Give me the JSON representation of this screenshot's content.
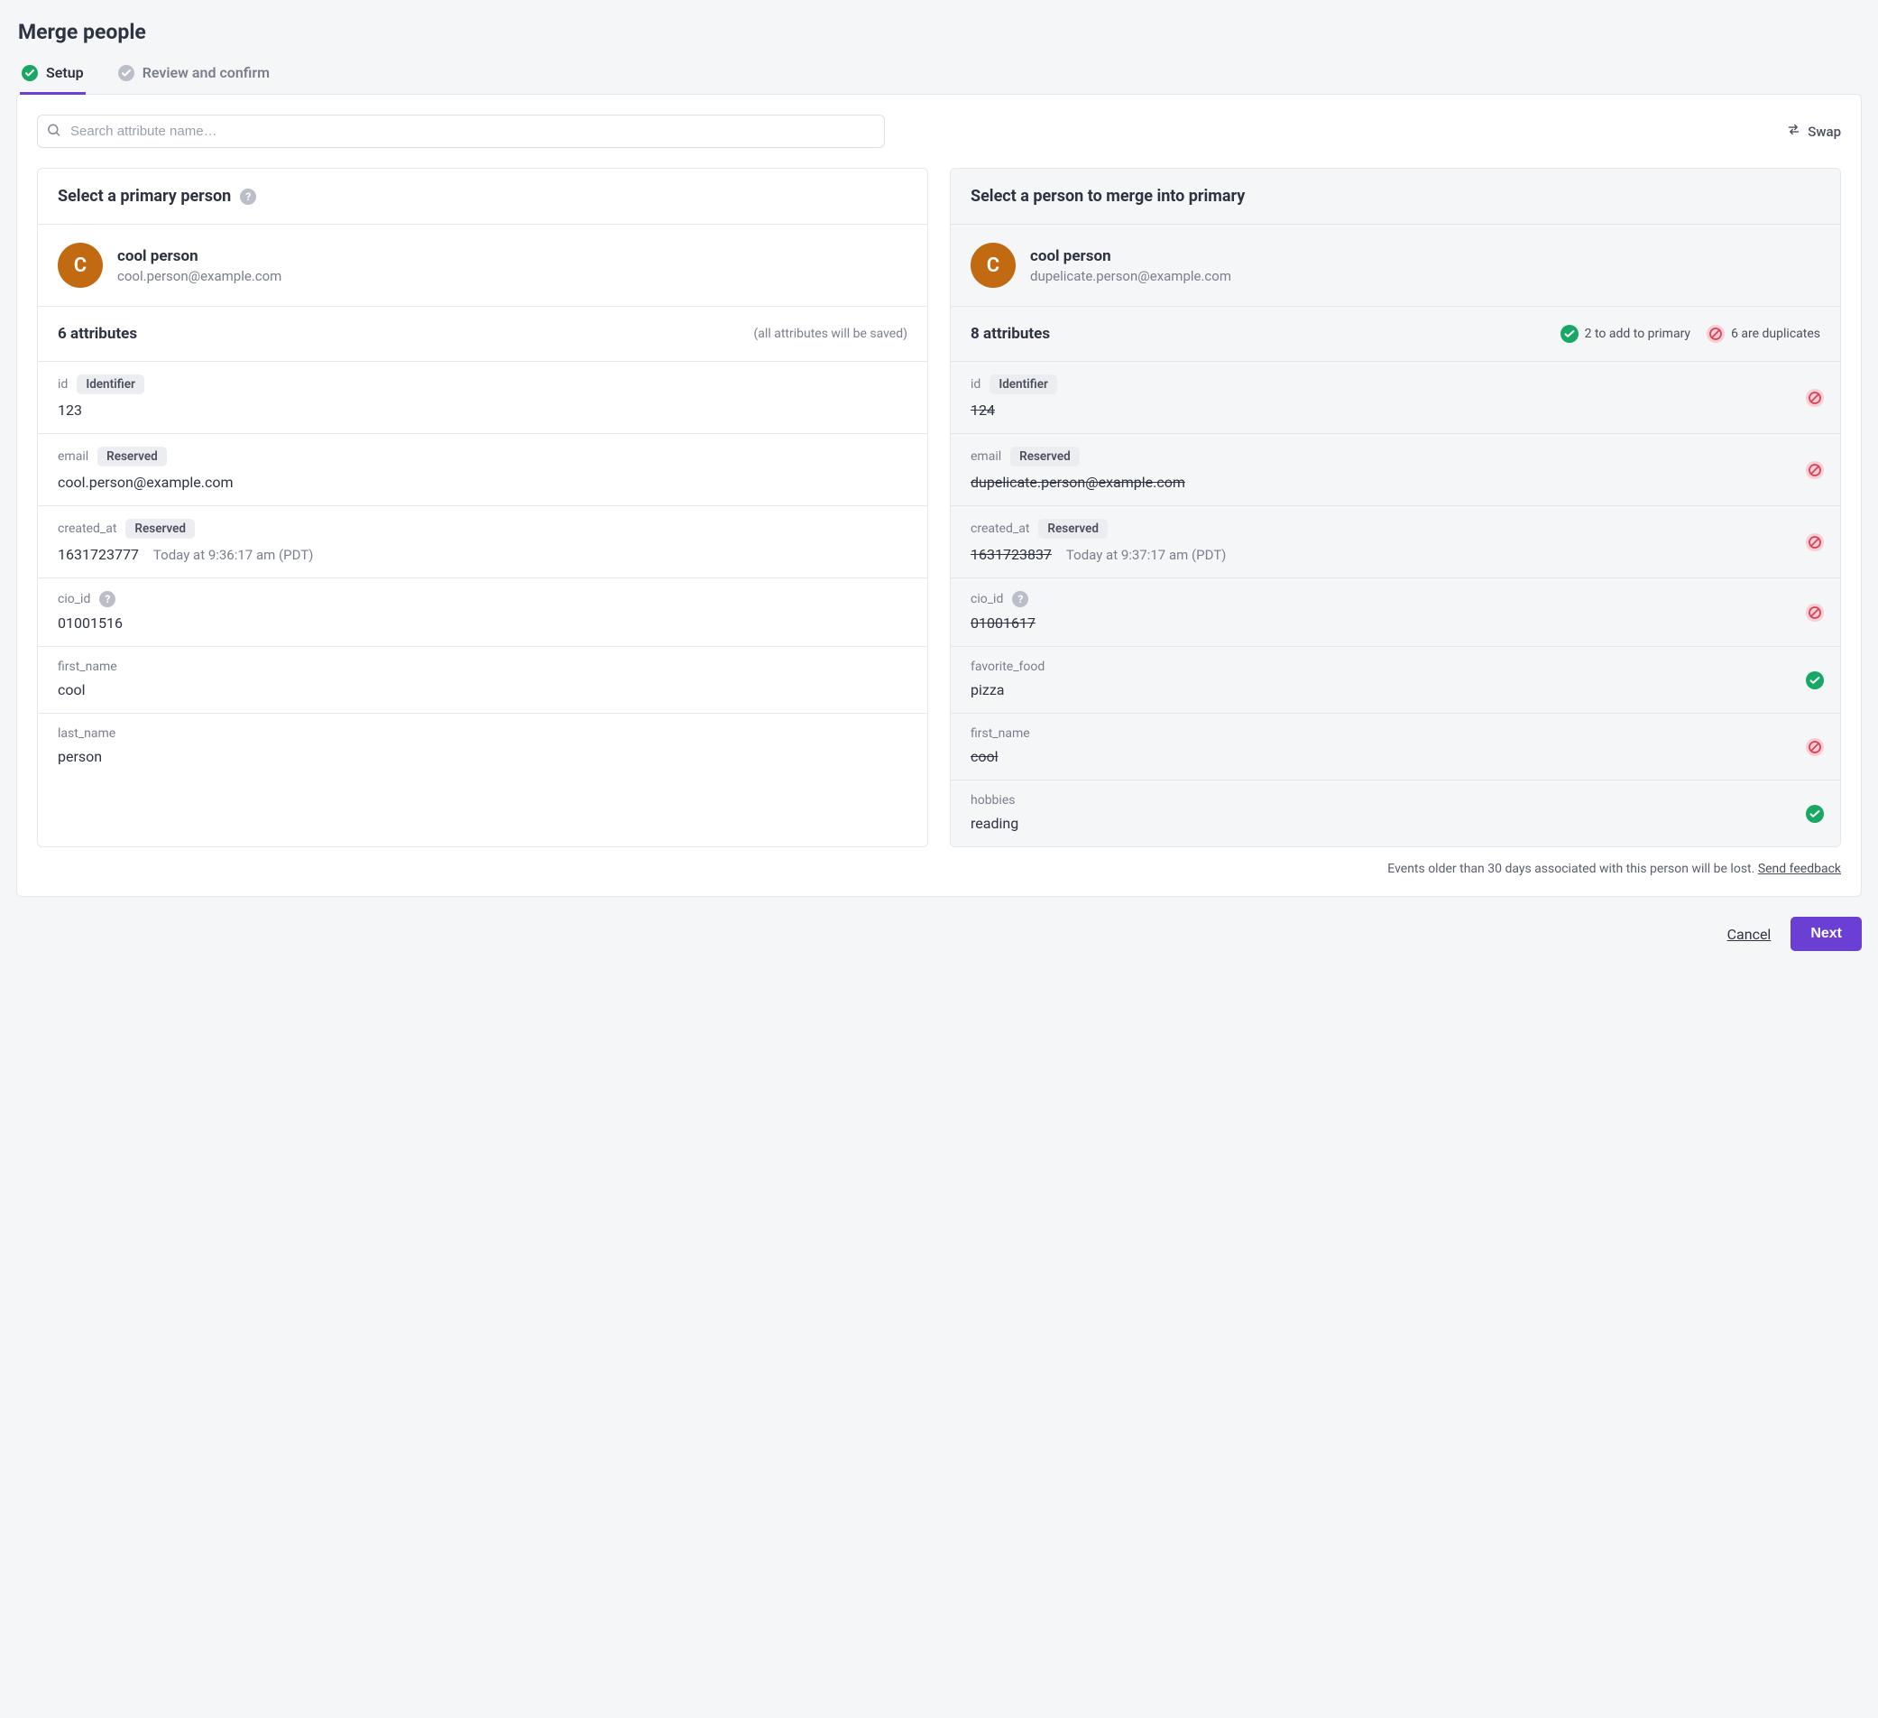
{
  "title": "Merge people",
  "tabs": {
    "setup": "Setup",
    "review": "Review and confirm"
  },
  "search": {
    "placeholder": "Search attribute name…"
  },
  "swap_label": "Swap",
  "primary": {
    "header": "Select a primary person",
    "avatar_initial": "C",
    "name": "cool person",
    "email": "cool.person@example.com",
    "attr_count_label": "6 attributes",
    "attr_note": "(all attributes will be saved)",
    "attributes": [
      {
        "key": "id",
        "chip": "Identifier",
        "value": "123"
      },
      {
        "key": "email",
        "chip": "Reserved",
        "value": "cool.person@example.com"
      },
      {
        "key": "created_at",
        "chip": "Reserved",
        "value": "1631723777",
        "secondary": "Today at 9:36:17 am (PDT)"
      },
      {
        "key": "cio_id",
        "help": true,
        "value": "01001516"
      },
      {
        "key": "first_name",
        "value": "cool"
      },
      {
        "key": "last_name",
        "value": "person"
      }
    ]
  },
  "secondary": {
    "header": "Select a person to merge into primary",
    "avatar_initial": "C",
    "name": "cool person",
    "email": "dupelicate.person@example.com",
    "attr_count_label": "8 attributes",
    "badges": {
      "add": "2 to add to primary",
      "dup": "6 are duplicates"
    },
    "attributes": [
      {
        "key": "id",
        "chip": "Identifier",
        "value": "124",
        "status": "dup"
      },
      {
        "key": "email",
        "chip": "Reserved",
        "value": "dupelicate.person@example.com",
        "status": "dup"
      },
      {
        "key": "created_at",
        "chip": "Reserved",
        "value": "1631723837",
        "secondary": "Today at 9:37:17 am (PDT)",
        "status": "dup"
      },
      {
        "key": "cio_id",
        "help": true,
        "value": "01001617",
        "status": "dup"
      },
      {
        "key": "favorite_food",
        "value": "pizza",
        "status": "add"
      },
      {
        "key": "first_name",
        "value": "cool",
        "status": "dup"
      },
      {
        "key": "hobbies",
        "value": "reading",
        "status": "add"
      }
    ]
  },
  "footer_note": "Events older than 30 days associated with this person will be lost.",
  "footer_link": "Send feedback",
  "actions": {
    "cancel": "Cancel",
    "next": "Next"
  }
}
